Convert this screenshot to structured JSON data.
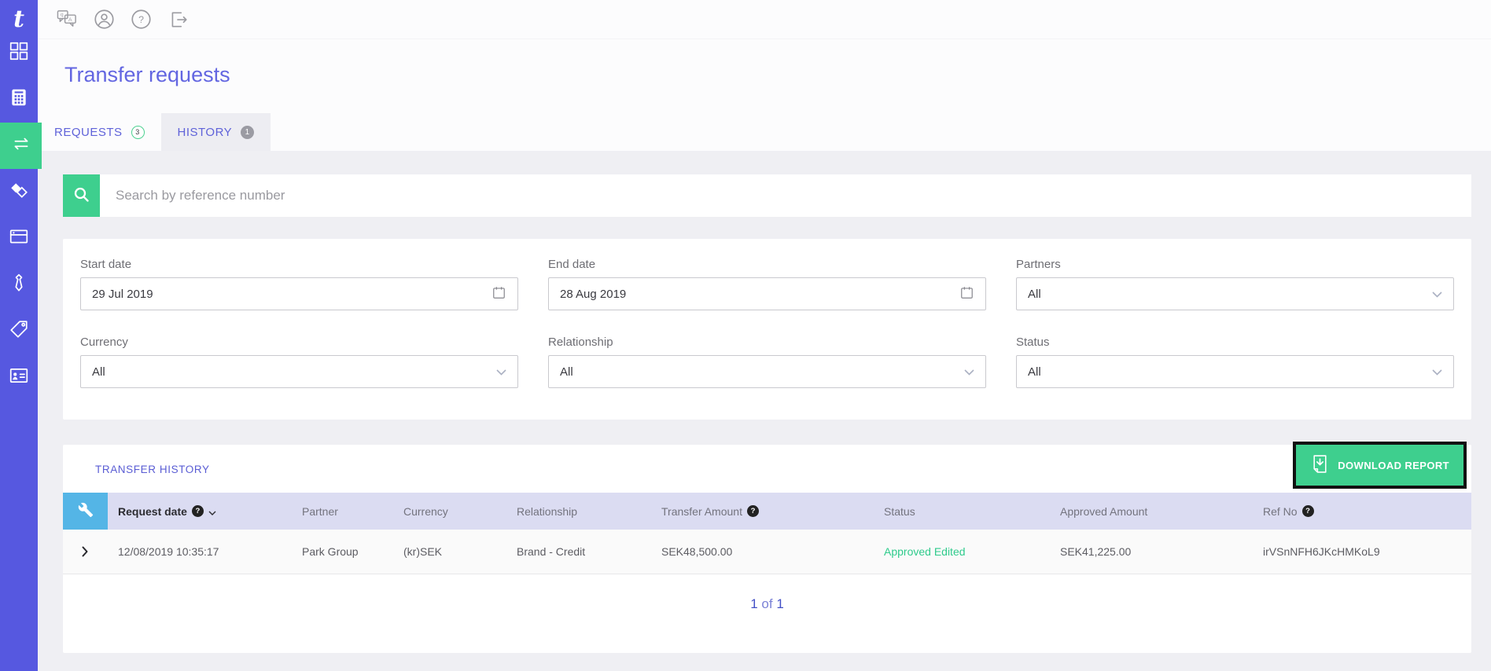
{
  "app": {
    "title": "Transfer requests"
  },
  "colors": {
    "sidebar": "#5658e0",
    "accent_green": "#3ecf8e",
    "title_purple": "#6366e1",
    "table_header_bg": "#dbdcf2",
    "tools_cell_blue": "#54b5e6",
    "status_green": "#2fcb8c"
  },
  "topbar": {
    "icons": [
      "translate",
      "profile",
      "help",
      "logout"
    ]
  },
  "sidebar": {
    "logo_letter": "t",
    "items": [
      {
        "id": "apps",
        "icon": "grid-icon",
        "active": false
      },
      {
        "id": "calculator",
        "icon": "calculator-icon",
        "active": false
      },
      {
        "id": "transfers",
        "icon": "transfer-arrows-icon",
        "active": true
      },
      {
        "id": "cards",
        "icon": "diamonds-icon",
        "active": false
      },
      {
        "id": "payments",
        "icon": "credit-card-icon",
        "active": false
      },
      {
        "id": "business",
        "icon": "tie-icon",
        "active": false
      },
      {
        "id": "pricing",
        "icon": "tag-icon",
        "active": false
      },
      {
        "id": "accounts",
        "icon": "id-card-icon",
        "active": false
      }
    ]
  },
  "tabs": [
    {
      "label": "REQUESTS",
      "badge": "3",
      "active": false
    },
    {
      "label": "HISTORY",
      "badge": "1",
      "active": true
    }
  ],
  "search": {
    "placeholder": "Search by reference number",
    "value": ""
  },
  "filters": {
    "start_date": {
      "label": "Start date",
      "value": "29 Jul 2019"
    },
    "end_date": {
      "label": "End date",
      "value": "28 Aug 2019"
    },
    "partners": {
      "label": "Partners",
      "value": "All"
    },
    "currency": {
      "label": "Currency",
      "value": "All"
    },
    "relationship": {
      "label": "Relationship",
      "value": "All"
    },
    "status": {
      "label": "Status",
      "value": "All"
    }
  },
  "history": {
    "section_title": "TRANSFER HISTORY",
    "download_label": "DOWNLOAD REPORT",
    "columns": [
      {
        "label": "Request date",
        "help": true,
        "sorted": "desc"
      },
      {
        "label": "Partner"
      },
      {
        "label": "Currency"
      },
      {
        "label": "Relationship"
      },
      {
        "label": "Transfer Amount",
        "help": true
      },
      {
        "label": "Status"
      },
      {
        "label": "Approved Amount"
      },
      {
        "label": "Ref No",
        "help": true
      }
    ],
    "rows": [
      {
        "request_date": "12/08/2019 10:35:17",
        "partner": "Park Group",
        "currency": "(kr)SEK",
        "relationship": "Brand - Credit",
        "transfer_amount": "SEK48,500.00",
        "status": "Approved Edited",
        "approved_amount": "SEK41,225.00",
        "ref_no": "irVSnNFH6JKcHMKoL9"
      }
    ],
    "pagination": {
      "current": "1",
      "separator": "of",
      "total": "1"
    }
  }
}
